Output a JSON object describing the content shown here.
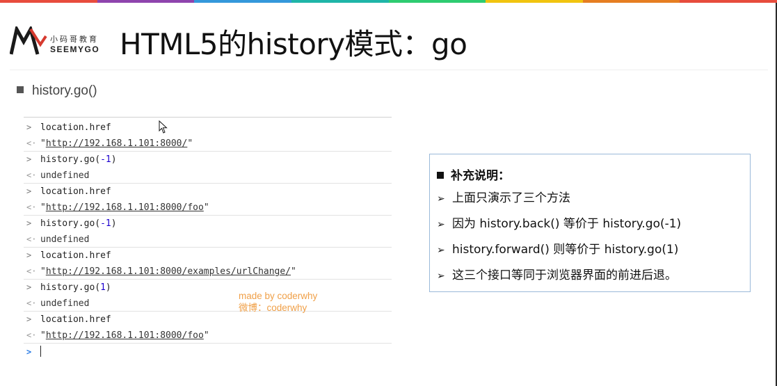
{
  "brand": {
    "stripe_colors": [
      "#e84c3d",
      "#8e44ad",
      "#3498db",
      "#1fb5a8",
      "#2ecc71",
      "#f1c40f",
      "#e67e22",
      "#e74c3c"
    ],
    "logo_cn": "小码哥教育",
    "logo_en": "SEEMYGO"
  },
  "slide": {
    "title": "HTML5的history模式：go",
    "section_label": "history.go()"
  },
  "console": {
    "rows": [
      {
        "kind": "in",
        "arrow": ">",
        "text": "location.href"
      },
      {
        "kind": "out",
        "arrow": "<·",
        "q1": "\"",
        "url": "http://192.168.1.101:8000/",
        "q2": "\""
      },
      {
        "kind": "in",
        "arrow": ">",
        "pre": "history.go(",
        "num": "-1",
        "post": ")"
      },
      {
        "kind": "out",
        "arrow": "<·",
        "text": "undefined"
      },
      {
        "kind": "in",
        "arrow": ">",
        "text": "location.href"
      },
      {
        "kind": "out",
        "arrow": "<·",
        "q1": "\"",
        "url": "http://192.168.1.101:8000/foo",
        "q2": "\""
      },
      {
        "kind": "in",
        "arrow": ">",
        "pre": "history.go(",
        "num": "-1",
        "post": ")"
      },
      {
        "kind": "out",
        "arrow": "<·",
        "text": "undefined"
      },
      {
        "kind": "in",
        "arrow": ">",
        "text": "location.href"
      },
      {
        "kind": "out",
        "arrow": "<·",
        "q1": "\"",
        "url": "http://192.168.1.101:8000/examples/urlChange/",
        "q2": "\""
      },
      {
        "kind": "in",
        "arrow": ">",
        "pre": "history.go(",
        "num": "1",
        "post": ")"
      },
      {
        "kind": "out",
        "arrow": "<·",
        "text": "undefined"
      },
      {
        "kind": "in",
        "arrow": ">",
        "text": "location.href"
      },
      {
        "kind": "out",
        "arrow": "<·",
        "q1": "\"",
        "url": "http://192.168.1.101:8000/foo",
        "q2": "\""
      }
    ],
    "prompt_arrow": ">"
  },
  "watermark": {
    "line1": "made by coderwhy",
    "line2": "微博：coderwhy"
  },
  "note": {
    "heading": "补充说明：",
    "items": [
      "上面只演示了三个方法",
      "因为 history.back() 等价于 history.go(-1)",
      "history.forward() 则等价于 history.go(1)",
      "这三个接口等同于浏览器界面的前进后退。"
    ]
  }
}
